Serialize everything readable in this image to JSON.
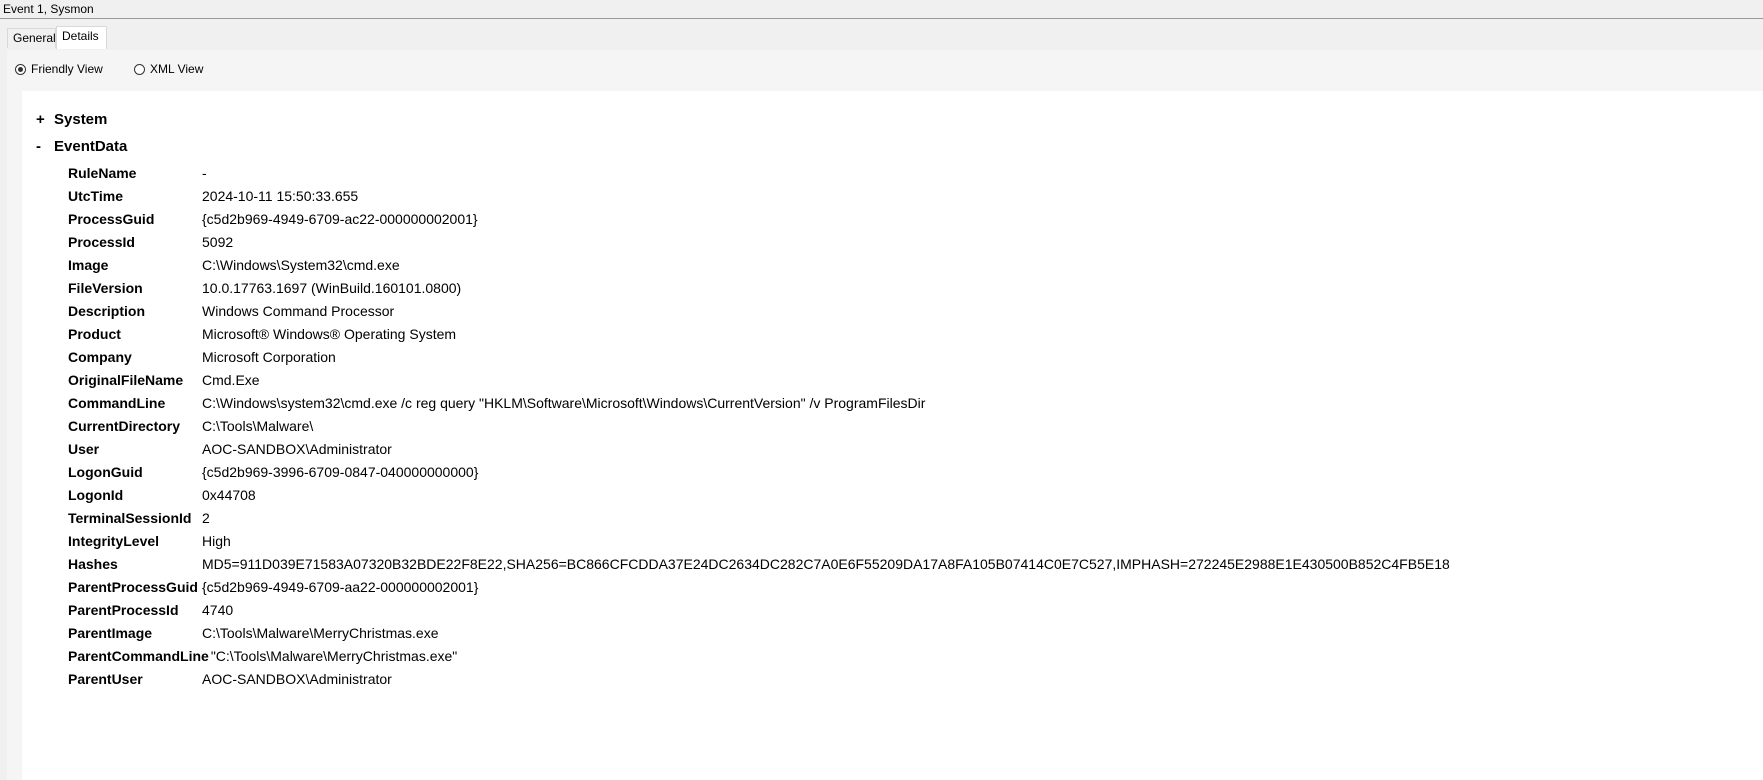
{
  "window": {
    "title": "Event 1, Sysmon"
  },
  "tabs": [
    {
      "label": "General",
      "active": false
    },
    {
      "label": "Details",
      "active": true
    }
  ],
  "view_options": {
    "friendly_label": "Friendly View",
    "xml_label": "XML View",
    "selected": "Friendly View"
  },
  "tree": {
    "system": {
      "toggle": "+",
      "label": "System"
    },
    "eventdata": {
      "toggle": "-",
      "label": "EventData"
    }
  },
  "event_data": [
    {
      "key": "RuleName",
      "value": "-"
    },
    {
      "key": "UtcTime",
      "value": "2024-10-11 15:50:33.655"
    },
    {
      "key": "ProcessGuid",
      "value": "{c5d2b969-4949-6709-ac22-000000002001}"
    },
    {
      "key": "ProcessId",
      "value": "5092"
    },
    {
      "key": "Image",
      "value": "C:\\Windows\\System32\\cmd.exe"
    },
    {
      "key": "FileVersion",
      "value": "10.0.17763.1697 (WinBuild.160101.0800)"
    },
    {
      "key": "Description",
      "value": "Windows Command Processor"
    },
    {
      "key": "Product",
      "value": "Microsoft® Windows® Operating System"
    },
    {
      "key": "Company",
      "value": "Microsoft Corporation"
    },
    {
      "key": "OriginalFileName",
      "value": "Cmd.Exe"
    },
    {
      "key": "CommandLine",
      "value": "C:\\Windows\\system32\\cmd.exe /c reg query \"HKLM\\Software\\Microsoft\\Windows\\CurrentVersion\" /v ProgramFilesDir"
    },
    {
      "key": "CurrentDirectory",
      "value": "C:\\Tools\\Malware\\"
    },
    {
      "key": "User",
      "value": "AOC-SANDBOX\\Administrator"
    },
    {
      "key": "LogonGuid",
      "value": "{c5d2b969-3996-6709-0847-040000000000}"
    },
    {
      "key": "LogonId",
      "value": "0x44708"
    },
    {
      "key": "TerminalSessionId",
      "value": "2"
    },
    {
      "key": "IntegrityLevel",
      "value": "High"
    },
    {
      "key": "Hashes",
      "value": "MD5=911D039E71583A07320B32BDE22F8E22,SHA256=BC866CFCDDA37E24DC2634DC282C7A0E6F55209DA17A8FA105B07414C0E7C527,IMPHASH=272245E2988E1E430500B852C4FB5E18"
    },
    {
      "key": "ParentProcessGuid",
      "value": "{c5d2b969-4949-6709-aa22-000000002001}"
    },
    {
      "key": "ParentProcessId",
      "value": "4740"
    },
    {
      "key": "ParentImage",
      "value": "C:\\Tools\\Malware\\MerryChristmas.exe"
    },
    {
      "key": "ParentCommandLine",
      "value": "\"C:\\Tools\\Malware\\MerryChristmas.exe\""
    },
    {
      "key": "ParentUser",
      "value": "AOC-SANDBOX\\Administrator"
    }
  ]
}
